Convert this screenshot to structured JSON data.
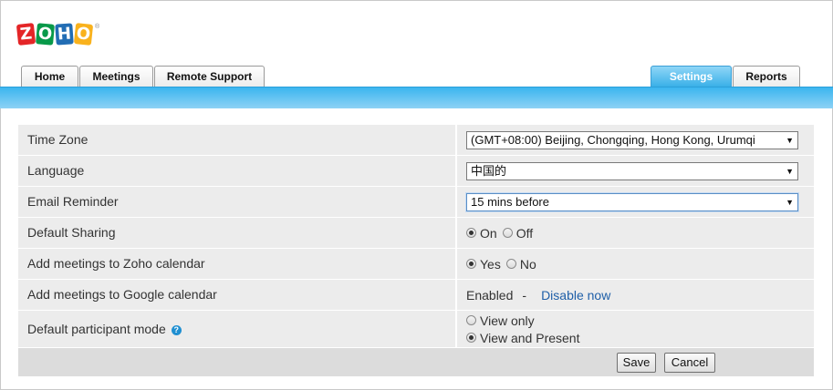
{
  "logo": {
    "letters": [
      "Z",
      "O",
      "H",
      "O"
    ],
    "colors": [
      "#e42527",
      "#089949",
      "#226db4",
      "#f9b21d"
    ],
    "registered": "®"
  },
  "tabs_left": [
    {
      "label": "Home"
    },
    {
      "label": "Meetings"
    },
    {
      "label": "Remote Support"
    }
  ],
  "tabs_right": [
    {
      "label": "Settings",
      "active": true
    },
    {
      "label": "Reports"
    }
  ],
  "accent_color": "#3bb5ef",
  "settings": {
    "time_zone": {
      "label": "Time Zone",
      "value": "(GMT+08:00) Beijing, Chongqing, Hong Kong, Urumqi"
    },
    "language": {
      "label": "Language",
      "value": "中国的"
    },
    "email_reminder": {
      "label": "Email Reminder",
      "value": "15 mins before"
    },
    "default_sharing": {
      "label": "Default Sharing",
      "options": [
        "On",
        "Off"
      ],
      "selected": "On"
    },
    "zoho_calendar": {
      "label": "Add meetings to Zoho calendar",
      "options": [
        "Yes",
        "No"
      ],
      "selected": "Yes"
    },
    "google_calendar": {
      "label": "Add meetings to Google calendar",
      "status": "Enabled",
      "separator": "-",
      "action": "Disable now"
    },
    "participant_mode": {
      "label": "Default participant mode",
      "help_icon": "?",
      "options": [
        "View only",
        "View and Present"
      ],
      "selected": "View and Present"
    }
  },
  "buttons": {
    "save": "Save",
    "cancel": "Cancel"
  }
}
